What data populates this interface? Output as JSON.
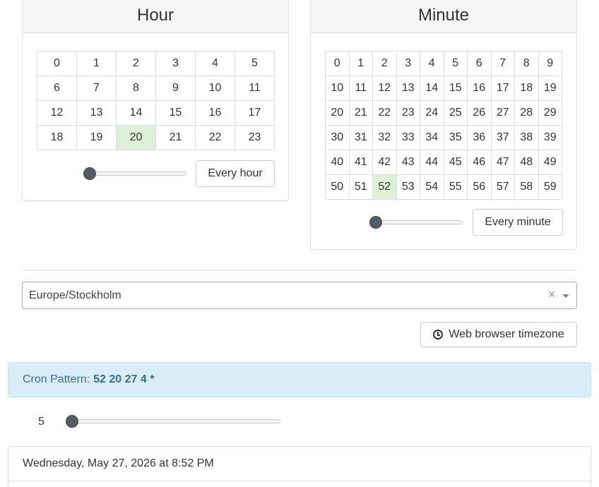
{
  "hour": {
    "title": "Hour",
    "rows": [
      [
        "0",
        "1",
        "2",
        "3",
        "4",
        "5"
      ],
      [
        "6",
        "7",
        "8",
        "9",
        "10",
        "11"
      ],
      [
        "12",
        "13",
        "14",
        "15",
        "16",
        "17"
      ],
      [
        "18",
        "19",
        "20",
        "21",
        "22",
        "23"
      ]
    ],
    "selected": "20",
    "slider_value": 0,
    "every_label": "Every hour"
  },
  "minute": {
    "title": "Minute",
    "rows": [
      [
        "0",
        "1",
        "2",
        "3",
        "4",
        "5",
        "6",
        "7",
        "8",
        "9"
      ],
      [
        "10",
        "11",
        "12",
        "13",
        "14",
        "15",
        "16",
        "17",
        "18",
        "19"
      ],
      [
        "20",
        "21",
        "22",
        "23",
        "24",
        "25",
        "26",
        "27",
        "28",
        "29"
      ],
      [
        "30",
        "31",
        "32",
        "33",
        "34",
        "35",
        "36",
        "37",
        "38",
        "39"
      ],
      [
        "40",
        "41",
        "42",
        "43",
        "44",
        "45",
        "46",
        "47",
        "48",
        "49"
      ],
      [
        "50",
        "51",
        "52",
        "53",
        "54",
        "55",
        "56",
        "57",
        "58",
        "59"
      ]
    ],
    "selected": "52",
    "slider_value": 0,
    "every_label": "Every minute"
  },
  "timezone": {
    "value": "Europe/Stockholm",
    "clear_glyph": "×",
    "browser_button_label": "Web browser timezone",
    "browser_button_icon": "clock-icon"
  },
  "cron": {
    "label": "Cron Pattern:",
    "pattern": "52 20 27 4 *"
  },
  "count": {
    "value": "5",
    "slider_value": 0
  },
  "dates": [
    "Wednesday, May 27, 2026 at 8:52 PM"
  ],
  "colors": {
    "selected_cell": "#dff0d8",
    "alert_bg": "#d9edf7",
    "alert_text": "#31708f"
  }
}
